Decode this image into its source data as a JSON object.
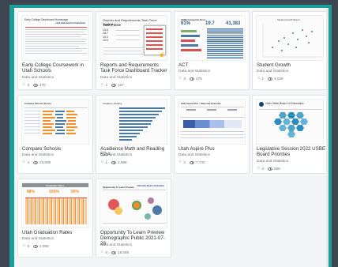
{
  "cards": [
    {
      "title": "Early College Coursework in Utah Schools",
      "author": "Data and Statistics",
      "stars": "3",
      "views": "470",
      "thumb": {
        "heading": "Early College Dashboard Homepage",
        "logo": "Utah State Board of Education"
      }
    },
    {
      "title": "Reports and Requirements Task Force Dashboard Tracker",
      "author": "Data and Statistics",
      "stars": "1",
      "views": "127",
      "thumb": {
        "heading": "Reports and Requirements Task Force Tracker",
        "subheading": "Task Force",
        "values": [
          "15.6",
          "18.7",
          "19.2",
          "19.9"
        ]
      }
    },
    {
      "title": "ACT",
      "author": "Data and Statistics",
      "stars": "3",
      "views": "476",
      "thumb": {
        "heading": "USBE Composite Score",
        "kpi_values": [
          "61%",
          "19.7",
          "41,383"
        ]
      }
    },
    {
      "title": "Student Growth",
      "author": "Data and Statistics",
      "stars": "1",
      "views": "4,039",
      "thumb": {
        "heading": "Student Growth Report"
      }
    },
    {
      "title": "Compare Schools",
      "author": "Data and Statistics",
      "stars": "4",
      "views": "23,809",
      "thumb": {
        "heading": "Compare Schools Scores"
      }
    },
    {
      "title": "Acadience Math and Reading EDA",
      "author": "Data and Statistics",
      "stars": "1",
      "views": "1,688",
      "thumb": {
        "heading": "Acadience Reading"
      }
    },
    {
      "title": "Utah Aspire Plus",
      "author": "Data and Statistics",
      "stars": "2",
      "views": "7,740",
      "thumb": {
        "heading": "Utah Aspire Plus - State and Overview"
      }
    },
    {
      "title": "Legislative Session 2022 USBE Board Priorities",
      "author": "Data and Statistics",
      "stars": "0",
      "views": "558",
      "thumb": {
        "heading": "Utah State Board of Education"
      }
    },
    {
      "title": "Utah Graduation Rates",
      "author": "Data and Statistics",
      "stars": "0",
      "views": "1,098",
      "thumb": {
        "heading": "Graduation Rates",
        "kpi_values": [
          "88%",
          "100%",
          "90%"
        ]
      }
    },
    {
      "title": "Opportunity To Learn Preview Demographic Public 2021-07-28",
      "author": "Data and Statistics",
      "stars": "0",
      "views": "18,558",
      "thumb": {
        "heading": "Opportunity To Learn Preview",
        "logo": "Utah State Board of Education"
      }
    }
  ],
  "icons": {
    "star": "star-icon",
    "views": "eye-icon"
  },
  "colors": {
    "frame": "#1f9e98",
    "background": "#3d4650",
    "panel": "#f3f4f5"
  }
}
